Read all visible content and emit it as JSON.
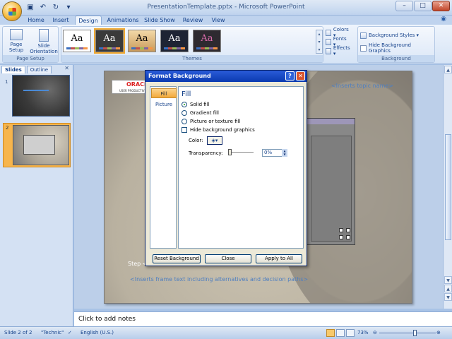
{
  "window": {
    "title": "PresentationTemplate.pptx - Microsoft PowerPoint",
    "controls": [
      "–",
      "□",
      "✕"
    ]
  },
  "ribbon_tabs": [
    "Home",
    "Insert",
    "Design",
    "Animations",
    "Slide Show",
    "Review",
    "View"
  ],
  "active_tab": "Design",
  "ribbon": {
    "page_setup": {
      "label": "Page Setup",
      "page_setup_btn": "Page Setup",
      "orientation_btn": "Slide Orientation ▾"
    },
    "themes": {
      "label": "Themes",
      "items": [
        "Aa",
        "Aa",
        "Aa",
        "Aa",
        "Aa"
      ],
      "colors": "Colors ▾",
      "fonts": "Fonts ▾",
      "effects": "Effects ▾"
    },
    "background": {
      "label": "Background",
      "styles": "Background Styles ▾",
      "hide_graphics": "Hide Background Graphics"
    }
  },
  "slides_pane": {
    "tabs": [
      "Slides",
      "Outline"
    ],
    "close": "✕",
    "thumbs": [
      "1",
      "2"
    ]
  },
  "slide": {
    "logo": "ORACLE",
    "logo_sub": "USER PRODUCTIV",
    "topic": "<Inserts topic name>",
    "step": "Step <",
    "frame_text": "<Inserts frame text including alternatives and decision paths>"
  },
  "notes_placeholder": "Click to add notes",
  "dialog": {
    "title": "Format Background",
    "nav": [
      "Fill",
      "Picture"
    ],
    "active_nav": "Fill",
    "section": "Fill",
    "options": {
      "solid": "Solid fill",
      "gradient": "Gradient fill",
      "picture": "Picture or texture fill",
      "hide": "Hide background graphics"
    },
    "color_label": "Color:",
    "transparency_label": "Transparency:",
    "transparency_value": "0%",
    "buttons": {
      "reset": "Reset Background",
      "close": "Close",
      "apply": "Apply to All"
    }
  },
  "status": {
    "slide": "Slide 2 of 2",
    "theme": "\"Technic\"",
    "language": "English (U.S.)",
    "zoom": "73%"
  }
}
